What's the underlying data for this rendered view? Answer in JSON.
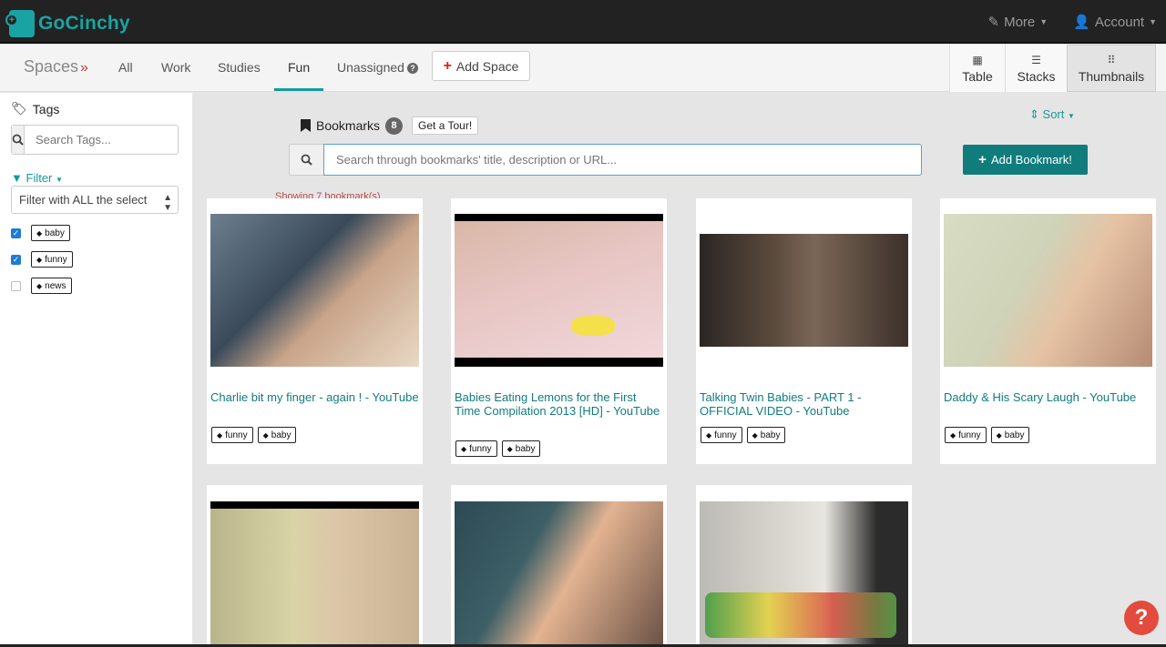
{
  "app": {
    "name": "GoCinchy"
  },
  "topnav": {
    "more": "More",
    "account": "Account"
  },
  "spaces": {
    "label": "Spaces",
    "tabs": [
      {
        "label": "All"
      },
      {
        "label": "Work"
      },
      {
        "label": "Studies"
      },
      {
        "label": "Fun",
        "active": true
      },
      {
        "label": "Unassigned"
      }
    ],
    "add_space": "Add Space"
  },
  "views": [
    {
      "label": "Table",
      "icon": "table-icon"
    },
    {
      "label": "Stacks",
      "icon": "stacks-icon"
    },
    {
      "label": "Thumbnails",
      "icon": "thumbnails-icon",
      "active": true
    }
  ],
  "sidebar": {
    "tags_title": "Tags",
    "search_placeholder": "Search Tags...",
    "filter_label": "Filter",
    "filter_value": "Filter with ALL the select",
    "tags": [
      {
        "name": "baby",
        "checked": true
      },
      {
        "name": "funny",
        "checked": true
      },
      {
        "name": "news",
        "checked": false
      }
    ]
  },
  "main": {
    "bookmarks_label": "Bookmarks",
    "bookmarks_count": "8",
    "tour_button": "Get a Tour!",
    "sort_label": "Sort",
    "search_placeholder": "Search through bookmarks' title, description or URL...",
    "add_bookmark": "Add Bookmark!",
    "showing_text": "Showing 7 bookmark(s)"
  },
  "cards": [
    {
      "title": "Charlie bit my finger - again ! - YouTube",
      "tags": [
        "funny",
        "baby"
      ]
    },
    {
      "title": "Babies Eating Lemons for the First Time Compilation 2013 [HD] - YouTube",
      "tags": [
        "funny",
        "baby"
      ]
    },
    {
      "title": "Talking Twin Babies - PART 1 - OFFICIAL VIDEO - YouTube",
      "tags": [
        "funny",
        "baby"
      ]
    },
    {
      "title": "Daddy & His Scary Laugh - YouTube",
      "tags": [
        "funny",
        "baby"
      ]
    },
    {
      "title": "",
      "tags": []
    },
    {
      "title": "",
      "tags": []
    },
    {
      "title": "",
      "tags": []
    }
  ],
  "colors": {
    "brand": "#1aa3a3",
    "accent": "#117c7c",
    "danger": "#d9230f",
    "checkbox": "#1e7bd6"
  }
}
